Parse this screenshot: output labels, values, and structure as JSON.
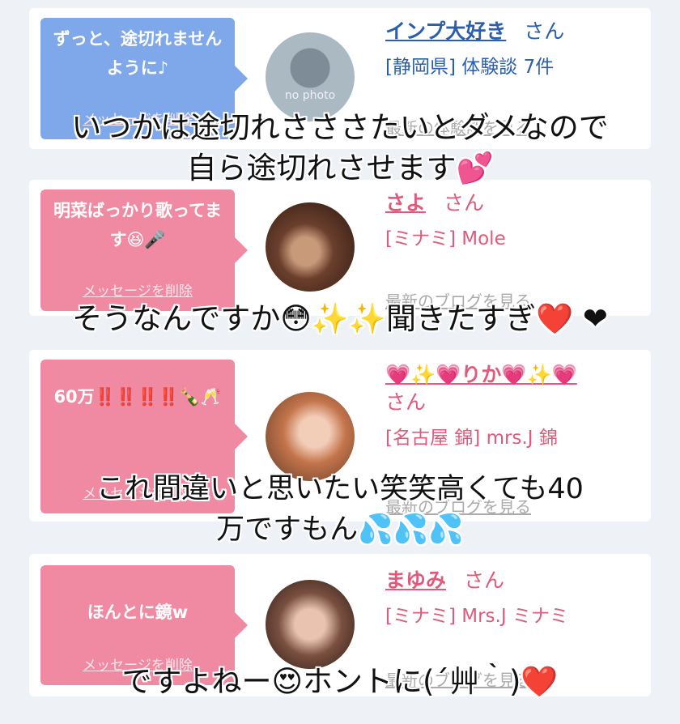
{
  "cards": [
    {
      "bubble_text": "ずっと、途切れませんように♪",
      "delete_label": "メッセージを削除",
      "name": "インプ大好き",
      "suffix": "さん",
      "shop": "[静岡県] 体験談 7件",
      "more_link": "最新の体験談を見る",
      "avatar_text": "no photo",
      "theme": "blue"
    },
    {
      "bubble_text": "明菜ばっかり歌ってます😆🎤",
      "delete_label": "メッセージを削除",
      "name": "さよ",
      "suffix": "さん",
      "shop": "[ミナミ] Mole",
      "more_link": "最新のブログを見る",
      "theme": "pink"
    },
    {
      "bubble_text": "60万‼️‼️‼️‼️🍾🥂",
      "delete_label": "メッセージを削除",
      "name": "💗✨💗りか💗✨💗",
      "suffix": "さん",
      "shop": "[名古屋 錦] mrs.J 錦",
      "more_link": "最新のブログを見る",
      "theme": "pink"
    },
    {
      "bubble_text": "ほんとに鏡w",
      "delete_label": "メッセージを削除",
      "name": "まゆみ",
      "suffix": "さん",
      "shop": "[ミナミ] Mrs.J ミナミ",
      "more_link": "最新のブログを見る",
      "theme": "pink"
    }
  ],
  "captions": {
    "c1_line1": "いつかは途切れさささたいとダメなので",
    "c1_line2": "自ら途切れさせます💕",
    "c2": "そうなんですか😳✨✨聞きたすぎ❤️ ❤",
    "c3_line1": "これ間違いと思いたい笑笑高くても40",
    "c3_line2": "万ですもん💦💦💦",
    "c4": "ですよねー😍ホントに(´艸｀)❤️"
  }
}
